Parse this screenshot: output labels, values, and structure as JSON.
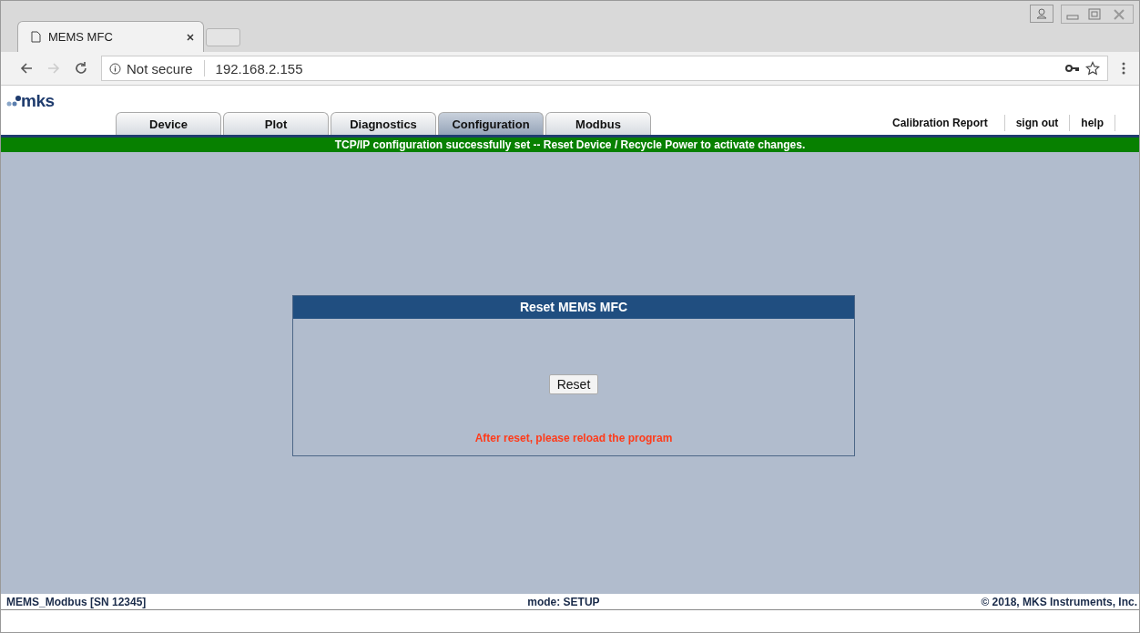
{
  "browser": {
    "tab_title": "MEMS MFC",
    "security": "Not secure",
    "url": "192.168.2.155"
  },
  "logo": "mks",
  "tabs": [
    {
      "label": "Device",
      "selected": false
    },
    {
      "label": "Plot",
      "selected": false
    },
    {
      "label": "Diagnostics",
      "selected": false
    },
    {
      "label": "Configuration",
      "selected": true
    },
    {
      "label": "Modbus",
      "selected": false
    }
  ],
  "links": [
    "Calibration Report",
    "sign out",
    "help"
  ],
  "banner": "TCP/IP configuration successfully set -- Reset Device / Recycle Power to activate changes.",
  "panel": {
    "title": "Reset MEMS MFC",
    "button": "Reset",
    "note": "After reset, please reload the program"
  },
  "status_bar": {
    "device": "MEMS_Modbus [SN 12345]",
    "mode": "mode: SETUP",
    "copyright": "© 2018, MKS Instruments, Inc."
  }
}
